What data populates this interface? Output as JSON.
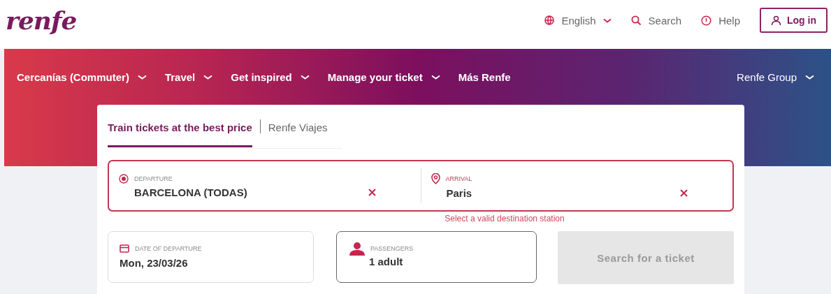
{
  "logo": "renfe",
  "top_links": [
    {
      "kind": "language",
      "label": "English"
    },
    {
      "kind": "search",
      "label": "Search"
    },
    {
      "kind": "help",
      "label": "Help"
    }
  ],
  "login_button": "Log in",
  "nav": {
    "items": [
      {
        "label": "Cercanías (Commuter)",
        "dropdown": true
      },
      {
        "label": "Travel",
        "dropdown": true
      },
      {
        "label": "Get inspired",
        "dropdown": true
      },
      {
        "label": "Manage your ticket",
        "dropdown": true
      },
      {
        "label": "Más Renfe",
        "dropdown": false
      }
    ],
    "group": {
      "label": "Renfe Group",
      "dropdown": true
    }
  },
  "tabs": [
    {
      "label": "Train tickets at the best price",
      "selected": true
    },
    {
      "label": "Renfe Viajes",
      "selected": false
    }
  ],
  "route": {
    "error": true,
    "departure": {
      "label": "DEPARTURE",
      "value": "BARCELONA (TODAS)"
    },
    "arrival": {
      "label": "ARRIVAL",
      "value": "Paris"
    },
    "error_message": "Select a valid destination station"
  },
  "date": {
    "label": "DATE OF DEPARTURE",
    "value": "Mon, 23/03/26"
  },
  "passengers": {
    "label": "PASSENGERS",
    "value": "1 adult"
  },
  "search_button": {
    "label": "Search for a ticket",
    "disabled": true
  }
}
